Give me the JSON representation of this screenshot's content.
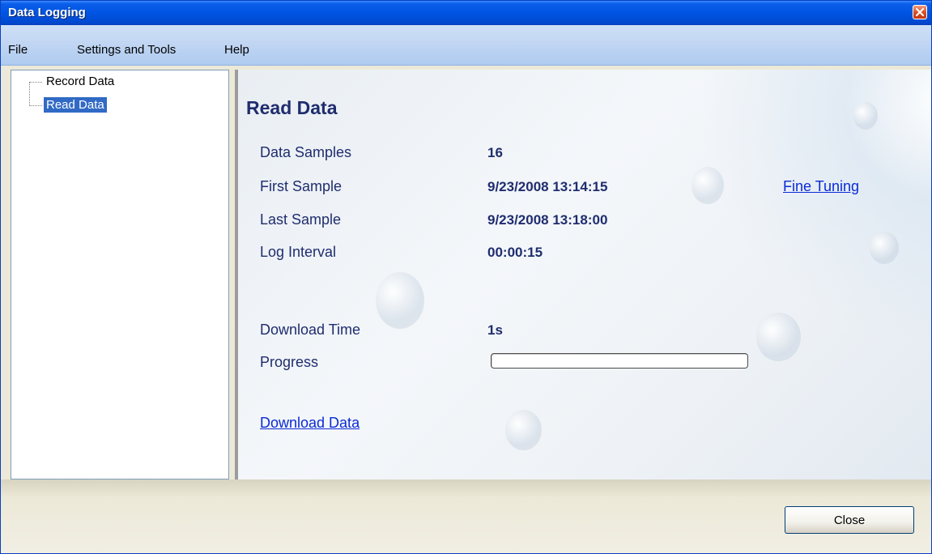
{
  "window": {
    "title": "Data Logging",
    "close_icon": "close-icon"
  },
  "menu": {
    "items": [
      "File",
      "Settings and Tools",
      "Help"
    ]
  },
  "tree": {
    "items": [
      {
        "label": "Record Data",
        "selected": false
      },
      {
        "label": "Read Data",
        "selected": true
      }
    ]
  },
  "content": {
    "heading": "Read Data",
    "rows": [
      {
        "label": "Data Samples",
        "value": "16"
      },
      {
        "label": "First Sample",
        "value": "9/23/2008 13:14:15"
      },
      {
        "label": "Last Sample",
        "value": "9/23/2008 13:18:00"
      },
      {
        "label": "Log Interval",
        "value": "00:00:15"
      },
      {
        "label": "Download Time",
        "value": "1s"
      }
    ],
    "progress": {
      "label": "Progress",
      "fraction": 0
    },
    "links": {
      "fine_tuning": "Fine Tuning",
      "download_data": "Download Data"
    }
  },
  "buttons": {
    "close_label": "Close"
  },
  "colors": {
    "titlebar": "#0054e3",
    "selection": "#316ac5",
    "label_text": "#1f2d6e",
    "link": "#0b2bd6"
  }
}
